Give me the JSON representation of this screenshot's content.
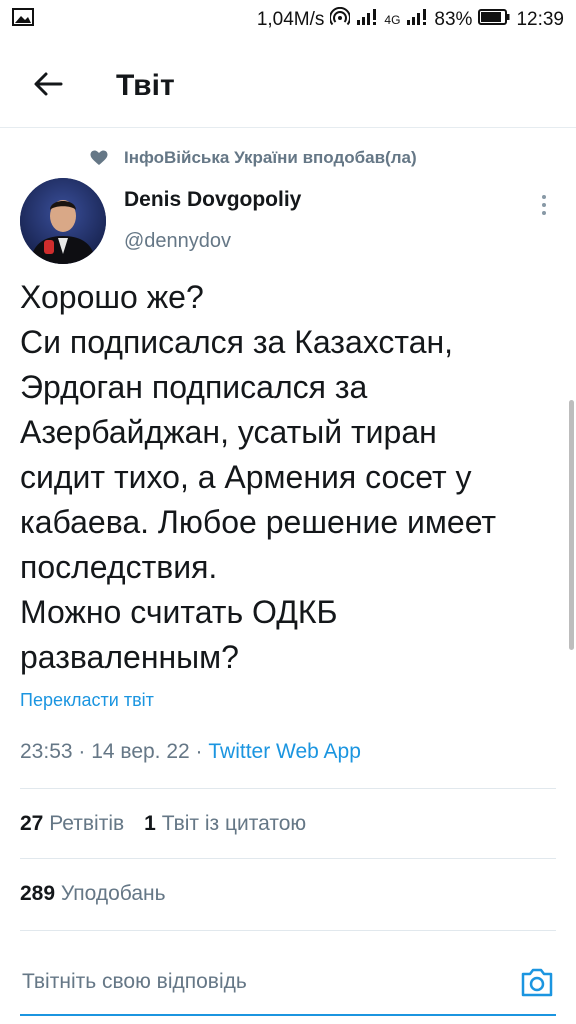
{
  "status_bar": {
    "speed": "1,04M/s",
    "network": "4G",
    "battery": "83%",
    "time": "12:39"
  },
  "header": {
    "title": "Твіт"
  },
  "social_context": {
    "text": "ІнфоВійська України вподобав(ла)"
  },
  "author": {
    "name": "Denis Dovgopoliy",
    "handle": "@dennydov"
  },
  "tweet": {
    "lines": [
      "Хорошо же?",
      "Си подписался за Казахстан,",
      "Эрдоган подписался за",
      "Азербайджан, усатый тиран",
      "сидит тихо, а Армения сосет у",
      "кабаева. Любое решение имеет",
      "последствия.",
      "Можно считать ОДКБ",
      "разваленным?"
    ],
    "translate_label": "Перекласти твіт",
    "timestamp": "23:53 · 14 вер. 22 · ",
    "source_app": "Twitter Web App"
  },
  "stats": {
    "retweets_count": "27",
    "retweets_label": "Ретвітів",
    "quotes_count": "1",
    "quotes_label": "Твіт із цитатою",
    "likes_count": "289",
    "likes_label": "Уподобань"
  },
  "reply": {
    "placeholder": "Твітніть свою відповідь"
  },
  "colors": {
    "accent": "#1b95e0",
    "secondary_text": "#657786",
    "divider": "#e1e8ed"
  }
}
